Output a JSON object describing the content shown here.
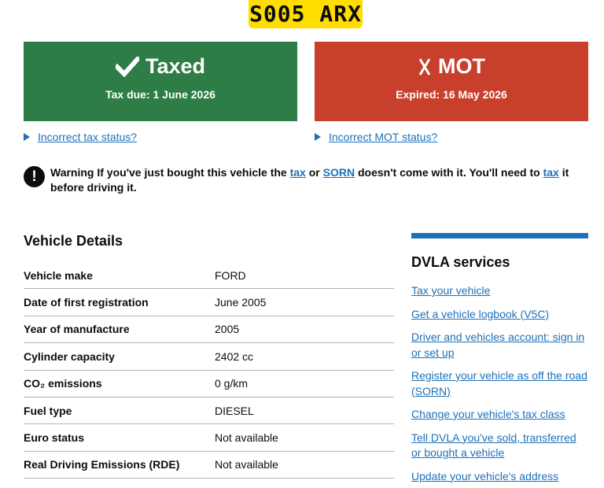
{
  "plate": "S005 ARX",
  "tax": {
    "title": "Taxed",
    "subtitle": "Tax due: 1 June 2026",
    "link": "Incorrect tax status?",
    "color": "#2e7d46"
  },
  "mot": {
    "title": "MOT",
    "subtitle": "Expired: 16 May 2026",
    "link": "Incorrect MOT status?",
    "color": "#c8402c"
  },
  "warning": {
    "icon": "!",
    "prefix": "Warning If you've just bought this vehicle the ",
    "link_tax_1": "tax",
    "mid1": " or ",
    "link_sorn": "SORN",
    "mid2": " doesn't come with it. You'll need to ",
    "link_tax_2": "tax",
    "suffix": " it before driving it."
  },
  "vehicle_details": {
    "title": "Vehicle Details",
    "rows": [
      {
        "key": "Vehicle make",
        "value": "FORD"
      },
      {
        "key": "Date of first registration",
        "value": "June 2005"
      },
      {
        "key": "Year of manufacture",
        "value": "2005"
      },
      {
        "key": "Cylinder capacity",
        "value": "2402 cc"
      },
      {
        "key": "CO₂ emissions",
        "value": "0 g/km"
      },
      {
        "key": "Fuel type",
        "value": "DIESEL"
      },
      {
        "key": "Euro status",
        "value": "Not available"
      },
      {
        "key": "Real Driving Emissions (RDE)",
        "value": "Not available"
      }
    ]
  },
  "services": {
    "title": "DVLA services",
    "items": [
      "Tax your vehicle",
      "Get a vehicle logbook (V5C)",
      "Driver and vehicles account: sign in or set up",
      "Register your vehicle as off the road (SORN)",
      "Change your vehicle's tax class",
      "Tell DVLA you've sold, transferred or bought a vehicle",
      "Update your vehicle's address"
    ]
  },
  "colors": {
    "link": "#1d70b8",
    "accent_bar": "#1d70b8",
    "plate": "#ffdd00"
  }
}
